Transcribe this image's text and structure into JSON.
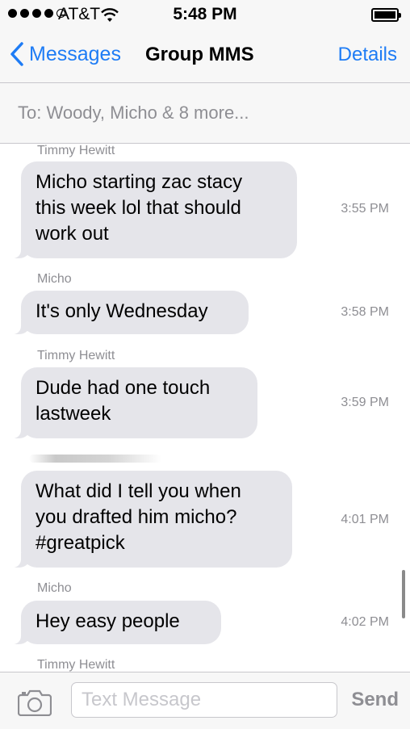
{
  "status_bar": {
    "carrier": "AT&T",
    "time": "5:48 PM"
  },
  "nav": {
    "back_label": "Messages",
    "title": "Group MMS",
    "details_label": "Details"
  },
  "recipients": {
    "text": "To: Woody, Micho & 8 more..."
  },
  "thread": {
    "messages": [
      {
        "sender": "Timmy Hewitt",
        "lines": [
          "Micho starting zac stacy",
          "this week lol that should",
          "work out"
        ],
        "time": "3:55 PM"
      },
      {
        "sender": "Micho",
        "lines": [
          "It's only Wednesday"
        ],
        "time": "3:58 PM"
      },
      {
        "sender": "Timmy Hewitt",
        "lines": [
          "Dude had one touch",
          "lastweek"
        ],
        "time": "3:59 PM"
      },
      {
        "sender": "",
        "lines": [
          "What did I tell you when",
          "you drafted him micho?",
          "#greatpick"
        ],
        "time": "4:01 PM"
      },
      {
        "sender": "Micho",
        "lines": [
          "Hey easy people"
        ],
        "time": "4:02 PM"
      },
      {
        "sender": "Timmy Hewitt",
        "lines": [],
        "time": ""
      }
    ]
  },
  "composer": {
    "placeholder": "Text Message",
    "value": "",
    "send_label": "Send"
  },
  "colors": {
    "accent": "#1e7cf5",
    "bubble": "#e5e5ea",
    "meta": "#8e8e93"
  },
  "icons": {
    "back": "chevron-left-icon",
    "camera": "camera-icon",
    "wifi": "wifi-icon",
    "battery": "battery-icon"
  }
}
